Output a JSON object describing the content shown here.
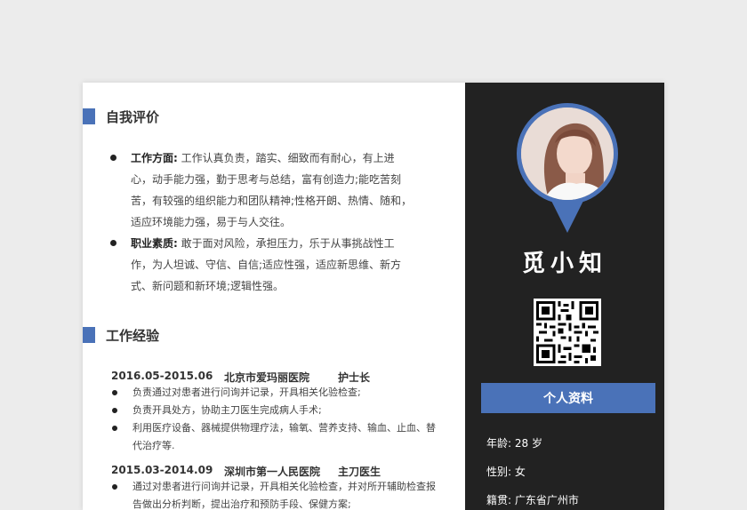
{
  "self_eval": {
    "title": "自我评价",
    "items": [
      {
        "label": "工作方面:",
        "text": " 工作认真负责，踏实、细致而有耐心，有上进心，动手能力强，勤于思考与总结，富有创造力;能吃苦刻苦，有较强的组织能力和团队精神;性格开朗、热情、随和，适应环境能力强，易于与人交往。"
      },
      {
        "label": "职业素质:",
        "text": " 敢于面对风险，承担压力，乐于从事挑战性工作，为人坦诚、守信、自信;适应性强，适应新思维、新方式、新问题和新环境;逻辑性强。"
      }
    ]
  },
  "work": {
    "title": "工作经验",
    "jobs": [
      {
        "period": "2016.05-2015.06",
        "org": "北京市爱玛丽医院",
        "role": "护士长",
        "items": [
          "负责通过对患者进行问询并记录，开具相关化验检查;",
          "负责开具处方，协助主刀医生完成病人手术;",
          "利用医疗设备、器械提供物理疗法，输氧、营养支持、输血、止血、替代治疗等."
        ]
      },
      {
        "period": "2015.03-2014.09",
        "org": "深圳市第一人民医院",
        "role": "主刀医生",
        "items": [
          "通过对患者进行问询并记录，开具相关化验检查，并对所开辅助检查报告做出分析判断，提出治疗和预防手段、保健方案;"
        ]
      }
    ]
  },
  "profile": {
    "name": "觅小知",
    "info_title": "个人资料",
    "age": "年龄:   28 岁",
    "gender": "性别:  女",
    "origin": "籍贯:  广东省广州市"
  },
  "colors": {
    "accent": "#4a72b8",
    "sidebar": "#222222"
  }
}
